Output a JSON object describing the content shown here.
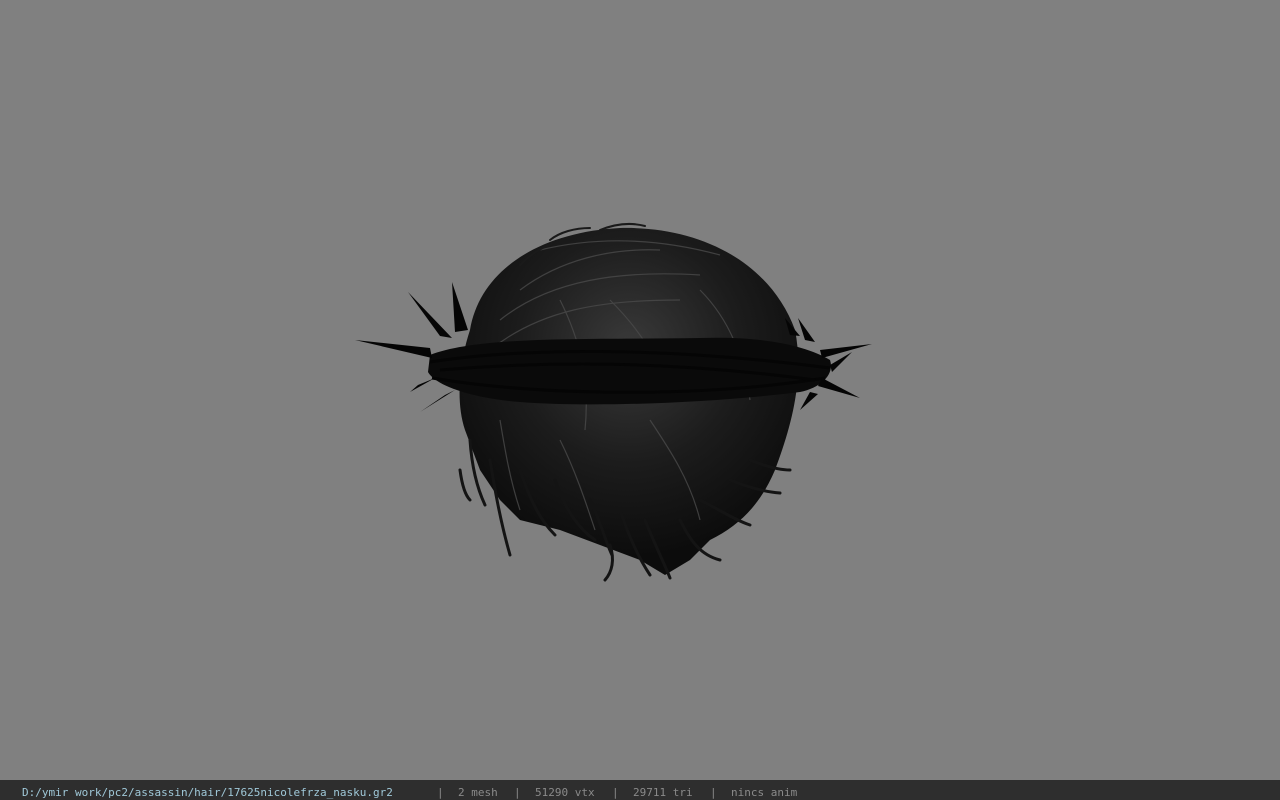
{
  "viewport": {
    "background": "#808080",
    "model": "hair mesh with crown of thorns"
  },
  "status_bar": {
    "file_path": "D:/ymir work/pc2/assassin/hair/17625nicolefrza_nasku.gr2",
    "separator": "|",
    "mesh_count": "2 mesh",
    "vertex_count": "51290 vtx",
    "triangle_count": "29711 tri",
    "anim_status": "nincs anim",
    "path_color": "#9fc8d8",
    "text_color": "#8a8a8a",
    "background": "#2e2e2e"
  }
}
